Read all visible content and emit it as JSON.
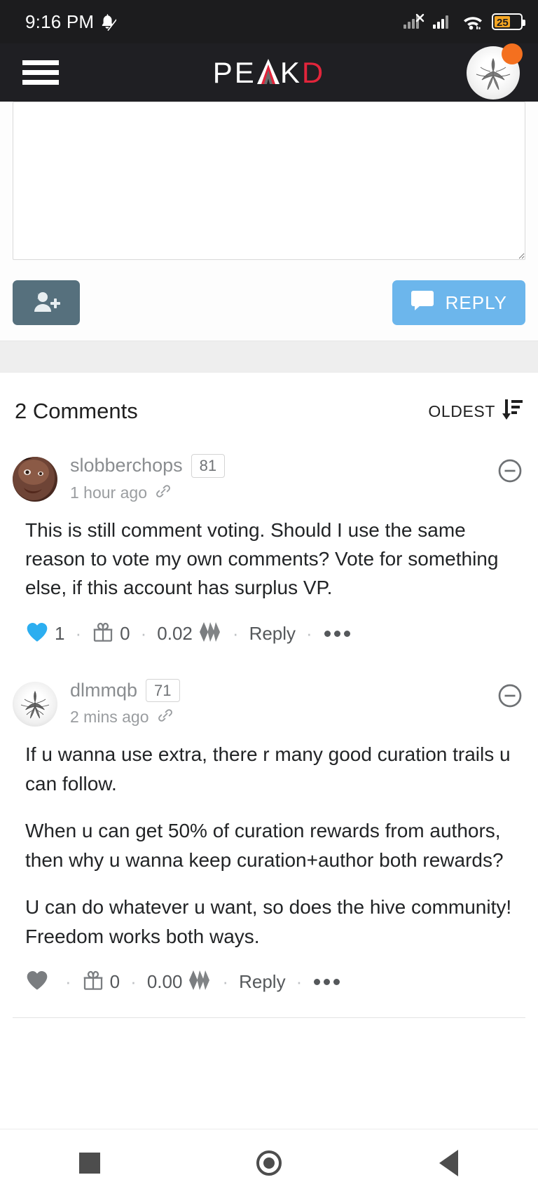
{
  "status_bar": {
    "time": "9:16 PM",
    "icons": [
      "bell-muted-icon",
      "signal-no-sim-icon",
      "signal-bars-icon",
      "wifi-icon",
      "battery-icon"
    ],
    "battery_percent": "25"
  },
  "header": {
    "menu_icon": "hamburger-icon",
    "brand": {
      "part1": "PE",
      "part_a": "A",
      "part2": "K",
      "part3": "D",
      "full": "PEAKD"
    },
    "avatar": "user-avatar",
    "notification_badge": true,
    "accent_red": "#e2253b",
    "bg": "#1f1f23"
  },
  "reply_editor": {
    "textarea_value": "",
    "textarea_placeholder": "",
    "add_user_label": "",
    "add_user_icon": "add-user-icon",
    "reply_button_label": "REPLY",
    "reply_button_icon": "comment-icon",
    "reply_button_color": "#6cb6ec",
    "add_user_button_color": "#56707d"
  },
  "comments_section": {
    "title": "2 Comments",
    "count": 2,
    "sort_label": "OLDEST",
    "sort_icon": "sort-descending-icon",
    "comments": [
      {
        "author": "slobberchops",
        "reputation": "81",
        "timestamp": "1 hour ago",
        "permlink_icon": "link-icon",
        "collapse_icon": "minus-circle-icon",
        "avatar": "slobberchops-avatar",
        "paragraphs": [
          "This is still comment voting. Should I use the same reason to vote my own comments? Vote for something else, if this account has surplus VP."
        ],
        "actions": {
          "vote_icon": "heart-icon",
          "voted": true,
          "vote_color": "#2caef0",
          "vote_count": "1",
          "gift_icon": "gift-icon",
          "gift_count": "0",
          "payout": "0.02",
          "payout_icon": "hive-logo-icon",
          "reply_label": "Reply",
          "more_icon": "more-dots-icon"
        }
      },
      {
        "author": "dlmmqb",
        "reputation": "71",
        "timestamp": "2 mins ago",
        "permlink_icon": "link-icon",
        "collapse_icon": "minus-circle-icon",
        "avatar": "dlmmqb-avatar",
        "paragraphs": [
          "If u wanna use extra, there r many good curation trails u can follow.",
          "When u can get 50% of curation rewards from authors, then why u wanna keep curation+author both rewards?",
          "U can do whatever u want, so does the hive community! Freedom works both ways."
        ],
        "actions": {
          "vote_icon": "heart-icon",
          "voted": false,
          "vote_color": "#7a7d80",
          "vote_count": "",
          "gift_icon": "gift-icon",
          "gift_count": "0",
          "payout": "0.00",
          "payout_icon": "hive-logo-icon",
          "reply_label": "Reply",
          "more_icon": "more-dots-icon"
        }
      }
    ]
  },
  "nav_bar": {
    "recents_label": "recents-button",
    "home_label": "home-button",
    "back_label": "back-button"
  }
}
